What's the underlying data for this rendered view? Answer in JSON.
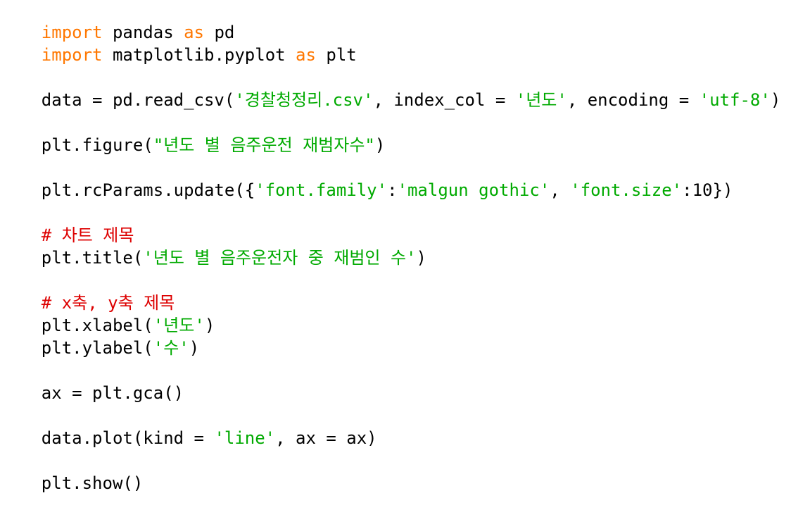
{
  "code": {
    "lines": [
      [
        {
          "t": "import",
          "c": "kw"
        },
        {
          "t": " pandas ",
          "c": "plain"
        },
        {
          "t": "as",
          "c": "kw"
        },
        {
          "t": " pd",
          "c": "plain"
        }
      ],
      [
        {
          "t": "import",
          "c": "kw"
        },
        {
          "t": " matplotlib.pyplot ",
          "c": "plain"
        },
        {
          "t": "as",
          "c": "kw"
        },
        {
          "t": " plt",
          "c": "plain"
        }
      ],
      [],
      [
        {
          "t": "data = pd.read_csv(",
          "c": "plain"
        },
        {
          "t": "'경찰청정리.csv'",
          "c": "str"
        },
        {
          "t": ", index_col = ",
          "c": "plain"
        },
        {
          "t": "'년도'",
          "c": "str"
        },
        {
          "t": ", encoding = ",
          "c": "plain"
        },
        {
          "t": "'utf-8'",
          "c": "str"
        },
        {
          "t": ")",
          "c": "plain"
        }
      ],
      [],
      [
        {
          "t": "plt.figure(",
          "c": "plain"
        },
        {
          "t": "\"년도 별 음주운전 재범자수\"",
          "c": "str"
        },
        {
          "t": ")",
          "c": "plain"
        }
      ],
      [],
      [
        {
          "t": "plt.rcParams.update({",
          "c": "plain"
        },
        {
          "t": "'font.family'",
          "c": "str"
        },
        {
          "t": ":",
          "c": "plain"
        },
        {
          "t": "'malgun gothic'",
          "c": "str"
        },
        {
          "t": ", ",
          "c": "plain"
        },
        {
          "t": "'font.size'",
          "c": "str"
        },
        {
          "t": ":10})",
          "c": "plain"
        }
      ],
      [],
      [
        {
          "t": "# 차트 제목",
          "c": "com"
        }
      ],
      [
        {
          "t": "plt.title(",
          "c": "plain"
        },
        {
          "t": "'년도 별 음주운전자 중 재범인 수'",
          "c": "str"
        },
        {
          "t": ")",
          "c": "plain"
        }
      ],
      [],
      [
        {
          "t": "# x축, y축 제목",
          "c": "com"
        }
      ],
      [
        {
          "t": "plt.xlabel(",
          "c": "plain"
        },
        {
          "t": "'년도'",
          "c": "str"
        },
        {
          "t": ")",
          "c": "plain"
        }
      ],
      [
        {
          "t": "plt.ylabel(",
          "c": "plain"
        },
        {
          "t": "'수'",
          "c": "str"
        },
        {
          "t": ")",
          "c": "plain"
        }
      ],
      [],
      [
        {
          "t": "ax = plt.gca()",
          "c": "plain"
        }
      ],
      [],
      [
        {
          "t": "data.plot(kind = ",
          "c": "plain"
        },
        {
          "t": "'line'",
          "c": "str"
        },
        {
          "t": ", ax = ax)",
          "c": "plain"
        }
      ],
      [],
      [
        {
          "t": "plt.show()",
          "c": "plain"
        }
      ]
    ]
  }
}
